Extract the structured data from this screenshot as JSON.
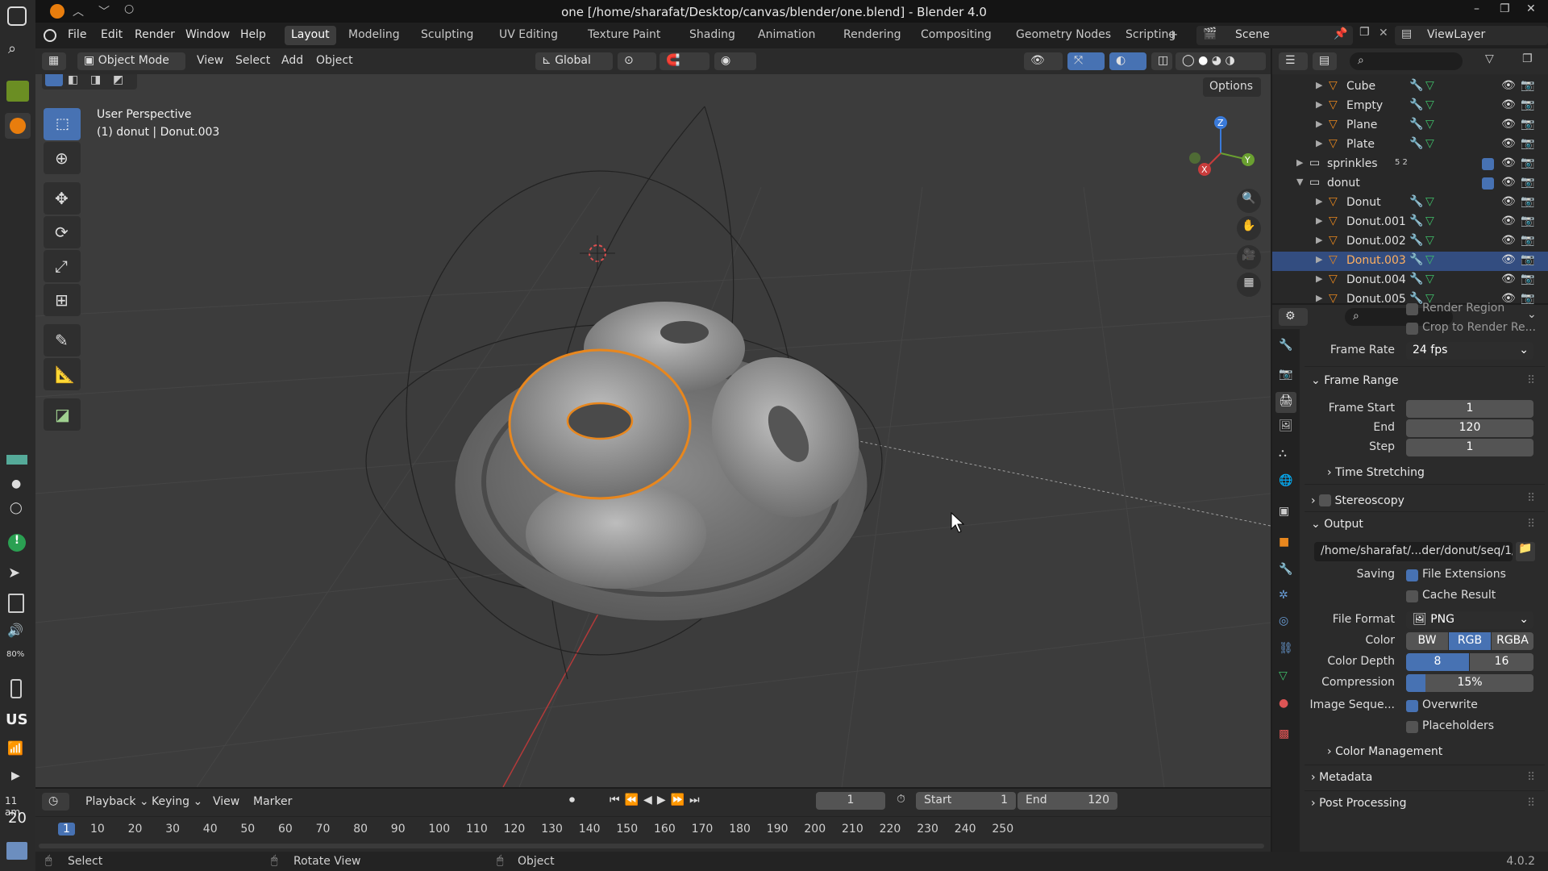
{
  "window": {
    "title": "one [/home/sharafat/Desktop/canvas/blender/one.blend] - Blender 4.0"
  },
  "dock": {
    "clock_time": "11 am",
    "clock_day": "20",
    "lang": "US",
    "battery": "80%"
  },
  "menu": {
    "items": [
      "File",
      "Edit",
      "Render",
      "Window",
      "Help"
    ]
  },
  "workspaces": {
    "tabs": [
      "Layout",
      "Modeling",
      "Sculpting",
      "UV Editing",
      "Texture Paint",
      "Shading",
      "Animation",
      "Rendering",
      "Compositing",
      "Geometry Nodes",
      "Scripting"
    ],
    "active": "Layout"
  },
  "scene": {
    "label": "Scene",
    "viewlayer": "ViewLayer"
  },
  "viewport_header": {
    "mode": "Object Mode",
    "view": "View",
    "select": "Select",
    "add": "Add",
    "object": "Object",
    "orientation": "Global",
    "options": "Options"
  },
  "viewport": {
    "perspective": "User Perspective",
    "object_info": "(1) donut | Donut.003"
  },
  "outliner": {
    "rows": [
      {
        "name": "Cube",
        "indent": 1
      },
      {
        "name": "Empty",
        "indent": 1
      },
      {
        "name": "Plane",
        "indent": 1
      },
      {
        "name": "Plate",
        "indent": 1
      },
      {
        "name": "sprinkles",
        "indent": 0,
        "badges": "5 2"
      },
      {
        "name": "donut",
        "indent": 0
      },
      {
        "name": "Donut",
        "indent": 1
      },
      {
        "name": "Donut.001",
        "indent": 1
      },
      {
        "name": "Donut.002",
        "indent": 1
      },
      {
        "name": "Donut.003",
        "indent": 1,
        "selected": true
      },
      {
        "name": "Donut.004",
        "indent": 1
      },
      {
        "name": "Donut.005",
        "indent": 1
      }
    ]
  },
  "props": {
    "render_region": "Render Region",
    "crop": "Crop to Render Re...",
    "frame_rate_label": "Frame Rate",
    "frame_rate": "24 fps",
    "frame_range": "Frame Range",
    "frame_start_label": "Frame Start",
    "frame_start": "1",
    "end_label": "End",
    "end": "120",
    "step_label": "Step",
    "step": "1",
    "time_stretching": "Time Stretching",
    "stereoscopy": "Stereoscopy",
    "output": "Output",
    "output_path": "/home/sharafat/...der/donut/seq/1/",
    "saving_label": "Saving",
    "file_extensions": "File Extensions",
    "cache_result": "Cache Result",
    "file_format_label": "File Format",
    "file_format": "PNG",
    "color_label": "Color",
    "color_bw": "BW",
    "color_rgb": "RGB",
    "color_rgba": "RGBA",
    "depth_label": "Color Depth",
    "depth_8": "8",
    "depth_16": "16",
    "compression_label": "Compression",
    "compression": "15%",
    "compression_value": 0.15,
    "image_seq_label": "Image Seque...",
    "overwrite": "Overwrite",
    "placeholders": "Placeholders",
    "color_management": "Color Management",
    "metadata": "Metadata",
    "post_processing": "Post Processing"
  },
  "timeline": {
    "playback": "Playback",
    "keying": "Keying",
    "view": "View",
    "marker": "Marker",
    "current_frame": "1",
    "start_label": "Start",
    "start": "1",
    "end_label": "End",
    "end": "120",
    "ticks": [
      "1",
      "10",
      "20",
      "30",
      "40",
      "50",
      "60",
      "70",
      "80",
      "90",
      "100",
      "110",
      "120",
      "130",
      "140",
      "150",
      "160",
      "170",
      "180",
      "190",
      "200",
      "210",
      "220",
      "230",
      "240",
      "250"
    ]
  },
  "status": {
    "select": "Select",
    "rotate": "Rotate View",
    "object": "Object",
    "version": "4.0.2"
  },
  "colors": {
    "accent": "#4772b3",
    "selection": "#e8871e",
    "bg": "#3c3c3c"
  }
}
